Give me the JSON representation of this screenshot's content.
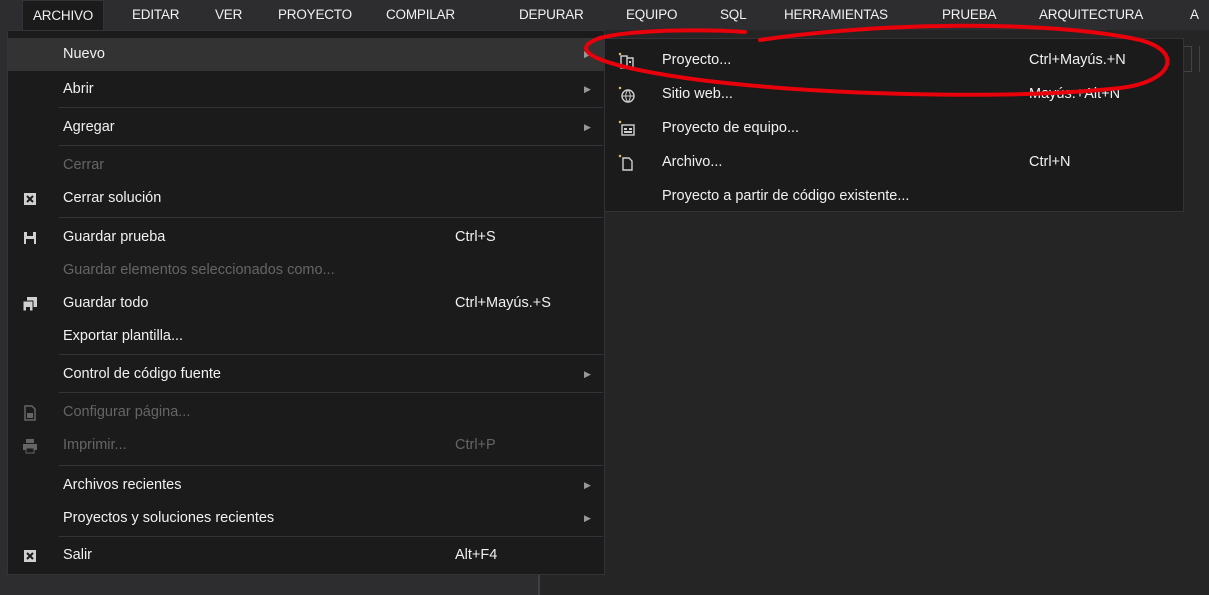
{
  "menubar": {
    "items": [
      "ARCHIVO",
      "EDITAR",
      "VER",
      "PROYECTO",
      "COMPILAR",
      "DEPURAR",
      "EQUIPO",
      "SQL",
      "HERRAMIENTAS",
      "PRUEBA",
      "ARQUITECTURA",
      "A"
    ]
  },
  "file_menu": {
    "items": [
      {
        "label": "Nuevo",
        "shortcut": "",
        "submenu": true,
        "disabled": false,
        "icon": ""
      },
      {
        "label": "Abrir",
        "shortcut": "",
        "submenu": true,
        "disabled": false,
        "icon": ""
      },
      {
        "label": "Agregar",
        "shortcut": "",
        "submenu": true,
        "disabled": false,
        "icon": ""
      },
      {
        "label": "Cerrar",
        "shortcut": "",
        "submenu": false,
        "disabled": true,
        "icon": ""
      },
      {
        "label": "Cerrar solución",
        "shortcut": "",
        "submenu": false,
        "disabled": false,
        "icon": "close-solution-icon"
      },
      {
        "label": "Guardar prueba",
        "shortcut": "Ctrl+S",
        "submenu": false,
        "disabled": false,
        "icon": "save-icon"
      },
      {
        "label": "Guardar elementos seleccionados como...",
        "shortcut": "",
        "submenu": false,
        "disabled": true,
        "icon": ""
      },
      {
        "label": "Guardar todo",
        "shortcut": "Ctrl+Mayús.+S",
        "submenu": false,
        "disabled": false,
        "icon": "save-all-icon"
      },
      {
        "label": "Exportar plantilla...",
        "shortcut": "",
        "submenu": false,
        "disabled": false,
        "icon": ""
      },
      {
        "label": "Control de código fuente",
        "shortcut": "",
        "submenu": true,
        "disabled": false,
        "icon": ""
      },
      {
        "label": "Configurar página...",
        "shortcut": "",
        "submenu": false,
        "disabled": true,
        "icon": "page-setup-icon"
      },
      {
        "label": "Imprimir...",
        "shortcut": "Ctrl+P",
        "submenu": false,
        "disabled": true,
        "icon": "printer-icon"
      },
      {
        "label": "Archivos recientes",
        "shortcut": "",
        "submenu": true,
        "disabled": false,
        "icon": ""
      },
      {
        "label": "Proyectos y soluciones recientes",
        "shortcut": "",
        "submenu": true,
        "disabled": false,
        "icon": ""
      },
      {
        "label": "Salir",
        "shortcut": "Alt+F4",
        "submenu": false,
        "disabled": false,
        "icon": "exit-icon"
      }
    ]
  },
  "new_submenu": {
    "items": [
      {
        "label": "Proyecto...",
        "shortcut": "Ctrl+Mayús.+N",
        "icon": "new-project-icon"
      },
      {
        "label": "Sitio web...",
        "shortcut": "Mayús.+Alt+N",
        "icon": "new-website-icon"
      },
      {
        "label": "Proyecto de equipo...",
        "shortcut": "",
        "icon": "team-project-icon"
      },
      {
        "label": "Archivo...",
        "shortcut": "Ctrl+N",
        "icon": "new-file-icon"
      },
      {
        "label": "Proyecto a partir de código existente...",
        "shortcut": "",
        "icon": ""
      }
    ]
  },
  "colors": {
    "menu_bg": "#1b1b1c",
    "chrome_bg": "#2d2d30",
    "annotation": "#e8000b"
  }
}
